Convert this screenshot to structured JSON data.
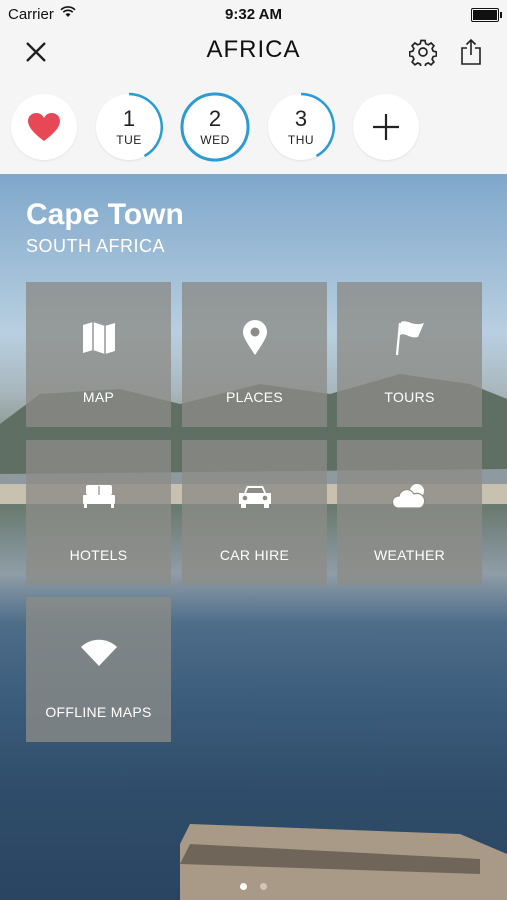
{
  "status_bar": {
    "carrier": "Carrier",
    "time": "9:32 AM"
  },
  "nav": {
    "title": "AFRICA",
    "icons": [
      "close-icon",
      "gear-icon",
      "share-icon"
    ]
  },
  "days": [
    {
      "number": "1",
      "weekday": "TUE",
      "selected": false
    },
    {
      "number": "2",
      "weekday": "WED",
      "selected": true
    },
    {
      "number": "3",
      "weekday": "THU",
      "selected": false
    }
  ],
  "colors": {
    "accent": "#2b9bd6",
    "favorite": "#e84855",
    "tile": "#8c8c87"
  },
  "city": {
    "name": "Cape Town",
    "country": "SOUTH AFRICA"
  },
  "tiles": [
    {
      "label": "MAP",
      "icon": "map-icon"
    },
    {
      "label": "PLACES",
      "icon": "pin-icon"
    },
    {
      "label": "TOURS",
      "icon": "flag-icon"
    },
    {
      "label": "HOTELS",
      "icon": "bed-icon"
    },
    {
      "label": "CAR HIRE",
      "icon": "car-icon"
    },
    {
      "label": "WEATHER",
      "icon": "cloud-sun-icon"
    },
    {
      "label": "OFFLINE MAPS",
      "icon": "wifi-icon"
    }
  ],
  "pager": {
    "pages": 2,
    "current": 1
  }
}
